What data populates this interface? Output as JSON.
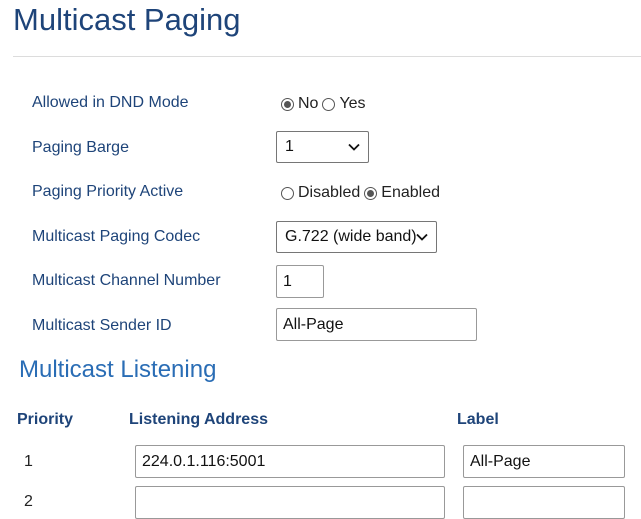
{
  "page": {
    "title": "Multicast Paging"
  },
  "settings": {
    "dnd": {
      "label": "Allowed in DND Mode",
      "options": [
        "No",
        "Yes"
      ],
      "selected": "No"
    },
    "barge": {
      "label": "Paging Barge",
      "value": "1"
    },
    "priority_active": {
      "label": "Paging Priority Active",
      "options": [
        "Disabled",
        "Enabled"
      ],
      "selected": "Enabled"
    },
    "codec": {
      "label": "Multicast Paging Codec",
      "value": "G.722 (wide band)"
    },
    "channel": {
      "label": "Multicast Channel Number",
      "value": "1"
    },
    "sender": {
      "label": "Multicast Sender ID",
      "value": "All-Page"
    }
  },
  "listening": {
    "title": "Multicast Listening",
    "headers": {
      "priority": "Priority",
      "address": "Listening Address",
      "label": "Label"
    },
    "rows": [
      {
        "priority": "1",
        "address": "224.0.1.116:5001",
        "label": "All-Page"
      },
      {
        "priority": "2",
        "address": "",
        "label": ""
      }
    ]
  }
}
